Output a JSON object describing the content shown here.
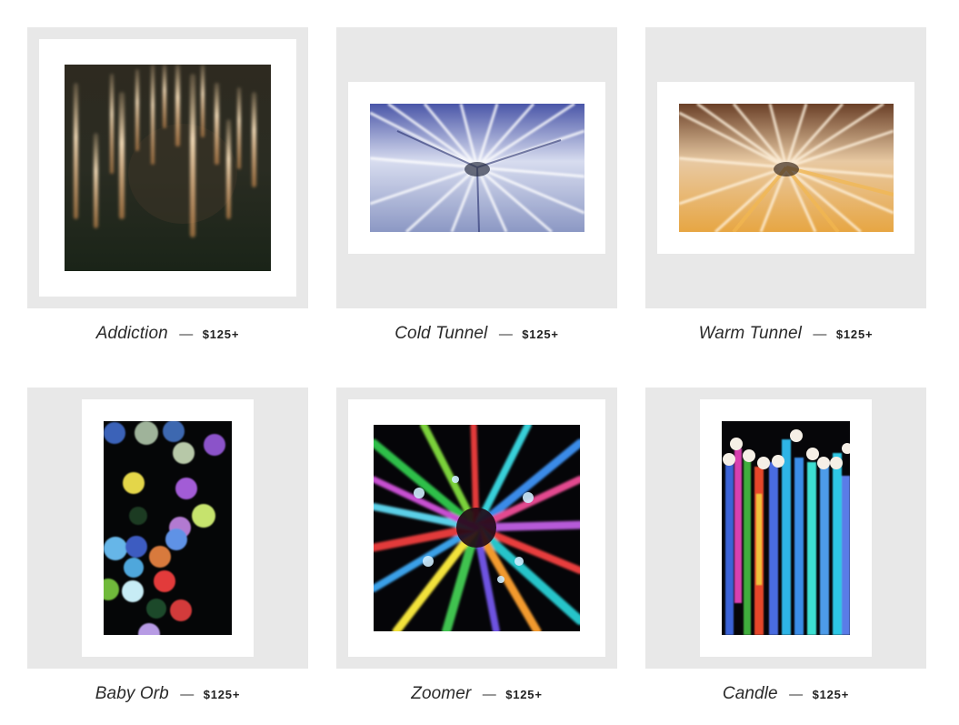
{
  "gallery": {
    "items": [
      {
        "title": "Addiction",
        "separator": "—",
        "price": "$125+",
        "image": "amber light streaks abstract"
      },
      {
        "title": "Cold Tunnel",
        "separator": "—",
        "price": "$125+",
        "image": "blue zoom tunnel abstract"
      },
      {
        "title": "Warm Tunnel",
        "separator": "—",
        "price": "$125+",
        "image": "orange zoom tunnel abstract"
      },
      {
        "title": "Baby Orb",
        "separator": "—",
        "price": "$125+",
        "image": "colorful bokeh orbs"
      },
      {
        "title": "Zoomer",
        "separator": "—",
        "price": "$125+",
        "image": "colorful zoom burst"
      },
      {
        "title": "Candle",
        "separator": "—",
        "price": "$125+",
        "image": "colorful vertical light streaks"
      }
    ]
  },
  "colors": {
    "tile_background": "#e8e8e8",
    "mat": "#ffffff",
    "text": "#2a2a2a"
  }
}
